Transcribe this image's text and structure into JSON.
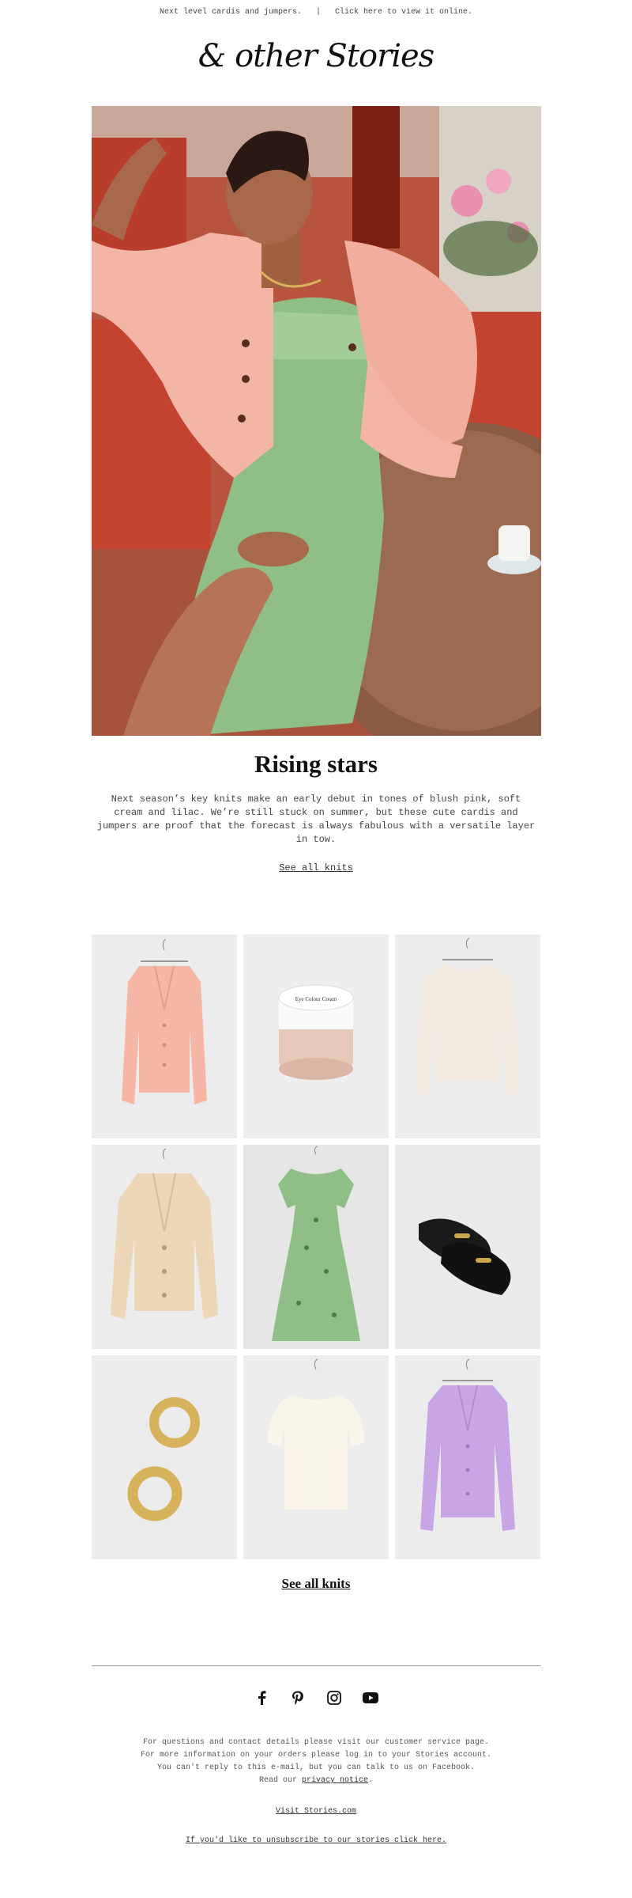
{
  "preheader": {
    "left": "Next level cardis and jumpers.",
    "separator": "|",
    "right": "Click here to view it online."
  },
  "brand": {
    "logo_text": "& other Stories"
  },
  "hero": {
    "image": "woman-in-pink-cardigan-and-green-dress-photo"
  },
  "headline": "Rising stars",
  "body_copy": "Next season’s key knits make an early debut in tones of blush pink, soft cream and lilac. We’re still stuck on summer, but these cute cardis and jumpers are proof that the forecast is always fabulous with a versatile layer in tow.",
  "cta_small": "See all knits",
  "products": [
    {
      "item": "pink-cardigan"
    },
    {
      "item": "beauty-cream-jar"
    },
    {
      "item": "cream-sweater"
    },
    {
      "item": "beige-knit-cardigan"
    },
    {
      "item": "green-floral-dress"
    },
    {
      "item": "black-loafers"
    },
    {
      "item": "gold-hoop-earrings"
    },
    {
      "item": "white-puff-sleeve-sweater"
    },
    {
      "item": "lilac-cardigan"
    }
  ],
  "cta_big": "See all knits",
  "social": [
    "facebook-icon",
    "pinterest-icon",
    "instagram-icon",
    "youtube-icon"
  ],
  "footer": {
    "line1": "For questions and contact details please visit our customer service page.",
    "line2": "For more information on your orders please log in to your Stories account.",
    "line3": "You can't reply to this e-mail, but you can talk to us on Facebook.",
    "line4_prefix": "Read our",
    "line4_link": "privacy notice",
    "line4_suffix": "."
  },
  "visit_link": "Visit Stories.com",
  "unsubscribe_link": "If you'd like to unsubscribe to our stories click here.",
  "colors": {
    "accent_pink": "#f3b5a6",
    "accent_green": "#8fbf86",
    "accent_lilac": "#c8a6e6",
    "background": "#ffffff"
  }
}
